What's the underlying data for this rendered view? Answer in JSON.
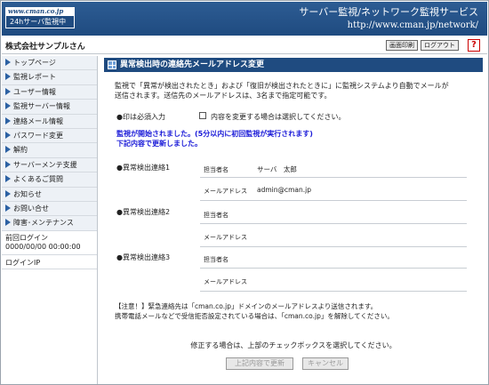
{
  "header": {
    "logo_url": "www.cman.co.jp",
    "logo_service": "24hサーバ監視中",
    "service_title": "サーバー監視/ネットワーク監視サービス",
    "service_url": "http://www.cman.jp/network/"
  },
  "companybar": {
    "company_name": "株式会社サンプルさん",
    "print_label": "画面印刷",
    "logout_label": "ログアウト",
    "help_label": "?"
  },
  "sidebar": {
    "items": [
      {
        "label": "トップページ"
      },
      {
        "label": "監視レポート"
      },
      {
        "label": "ユーザー情報"
      },
      {
        "label": "監視サーバー情報"
      },
      {
        "label": "連絡メール情報"
      },
      {
        "label": "パスワード変更"
      },
      {
        "label": "解約"
      },
      {
        "label": "サーバーメンテ支援"
      },
      {
        "label": "よくあるご質問"
      },
      {
        "label": "お知らせ"
      },
      {
        "label": "お問い合せ"
      },
      {
        "label": "障害･メンテナンス"
      }
    ],
    "last_login_label": "前回ログイン",
    "last_login_value": "0000/00/00 00:00:00",
    "login_ip_label": "ログインIP"
  },
  "main": {
    "section_title": "異常検出時の連絡先メールアドレス変更",
    "intro_line1": "監視で「異常が検出されたとき」および「復旧が検出されたときに」に監視システムより自動でメールが",
    "intro_line2": "送信されます。送信先のメールアドレスは、3名まで指定可能です。",
    "required_text": "●印は必須入力",
    "change_checkbox_label": "内容を変更する場合は選択してください。",
    "started_line1": "監視が開始されました。(5分以内に初回監視が実行されます)",
    "started_line2": "下記内容で更新しました。",
    "contacts": [
      {
        "label": "●異常検出連絡1",
        "name_label": "担当者名",
        "name_value": "サーバ　太郎",
        "mail_label": "メールアドレス",
        "mail_value": "admin@cman.jp"
      },
      {
        "label": "●異常検出連絡2",
        "name_label": "担当者名",
        "name_value": "",
        "mail_label": "メールアドレス",
        "mail_value": ""
      },
      {
        "label": "●異常検出連絡3",
        "name_label": "担当者名",
        "name_value": "",
        "mail_label": "メールアドレス",
        "mail_value": ""
      }
    ],
    "notice_line1": "【注意！】緊急連絡先は「cman.co.jp」ドメインのメールアドレスより送信されます。",
    "notice_line2": "携帯電話メールなどで受信拒否設定されている場合は、「cman.co.jp」を解除してください。",
    "footer_note": "修正する場合は、上部のチェックボックスを選択してください。",
    "update_button": "上記内容で更新",
    "cancel_button": "キャンセル"
  },
  "colors": {
    "header_blue": "#1f4b80",
    "started_text": "#1a1ad8",
    "nav_arrow": "#2c61a3"
  }
}
